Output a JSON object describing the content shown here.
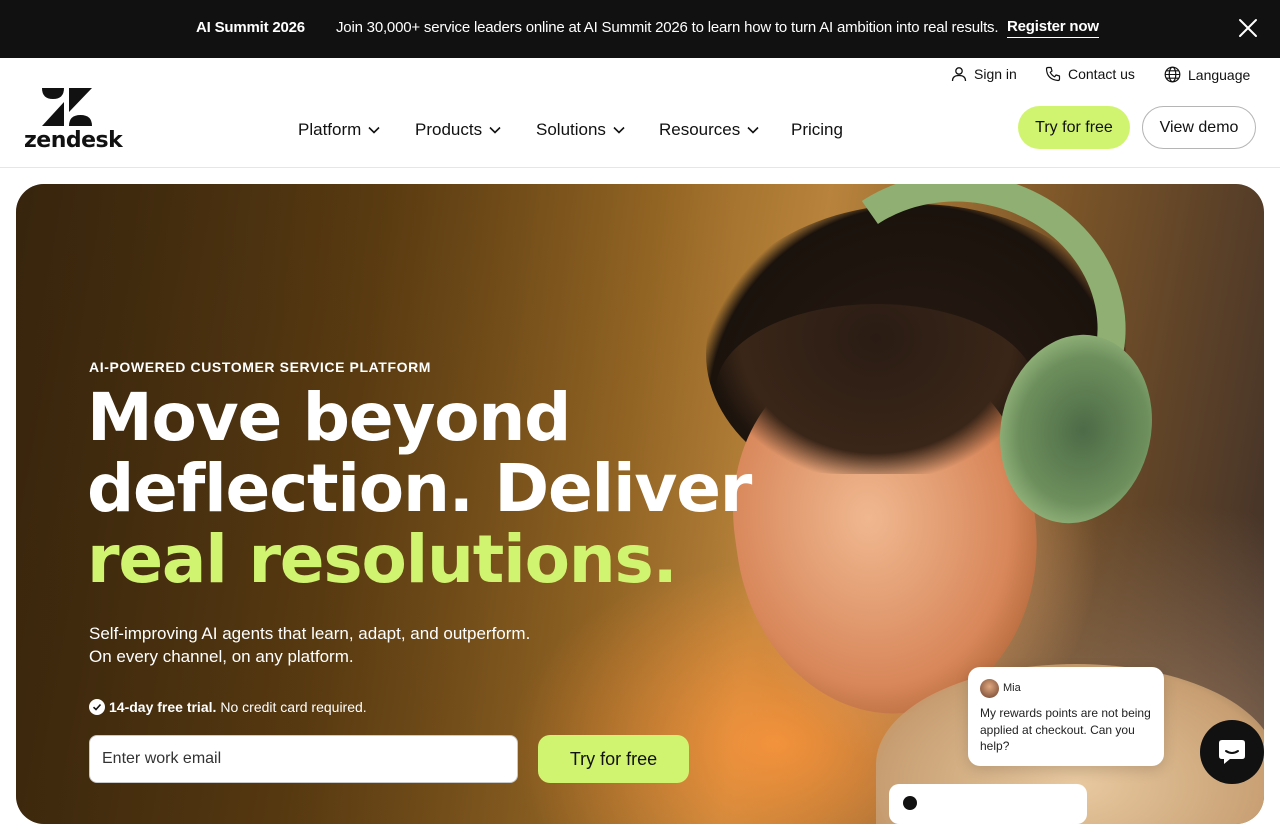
{
  "announcement": {
    "title": "AI Summit 2026",
    "text": "Join 30,000+ service leaders online at AI Summit 2026 to learn how to turn AI ambition into real results.",
    "link": "Register now",
    "close_icon": "close-icon"
  },
  "header": {
    "logo_text": "zendesk",
    "utility": [
      {
        "label": "Sign in",
        "icon": "person-icon"
      },
      {
        "label": "Contact us",
        "icon": "phone-icon"
      },
      {
        "label": "Language",
        "icon": "globe-icon"
      }
    ],
    "nav": [
      {
        "label": "Platform",
        "has_dropdown": true
      },
      {
        "label": "Products",
        "has_dropdown": true
      },
      {
        "label": "Solutions",
        "has_dropdown": true
      },
      {
        "label": "Resources",
        "has_dropdown": true
      },
      {
        "label": "Pricing",
        "has_dropdown": false
      }
    ],
    "try_button": "Try for free",
    "demo_button": "View demo"
  },
  "hero": {
    "eyebrow": "AI-POWERED CUSTOMER SERVICE PLATFORM",
    "headline_line1": "Move beyond",
    "headline_line2": "deflection. Deliver",
    "headline_accent": "real resolutions.",
    "subtitle_line1": "Self-improving AI agents that learn, adapt, and outperform.",
    "subtitle_line2": "On every channel, on any platform.",
    "trial_bold": "14-day free trial.",
    "trial_rest": "No credit card required.",
    "email_placeholder": "Enter work email",
    "try_button": "Try for free"
  },
  "chat_preview": {
    "name": "Mia",
    "message": "My rewards points are not being applied at checkout. Can you help?"
  },
  "colors": {
    "accent": "#d1f470",
    "announcement_bg": "#111111"
  }
}
